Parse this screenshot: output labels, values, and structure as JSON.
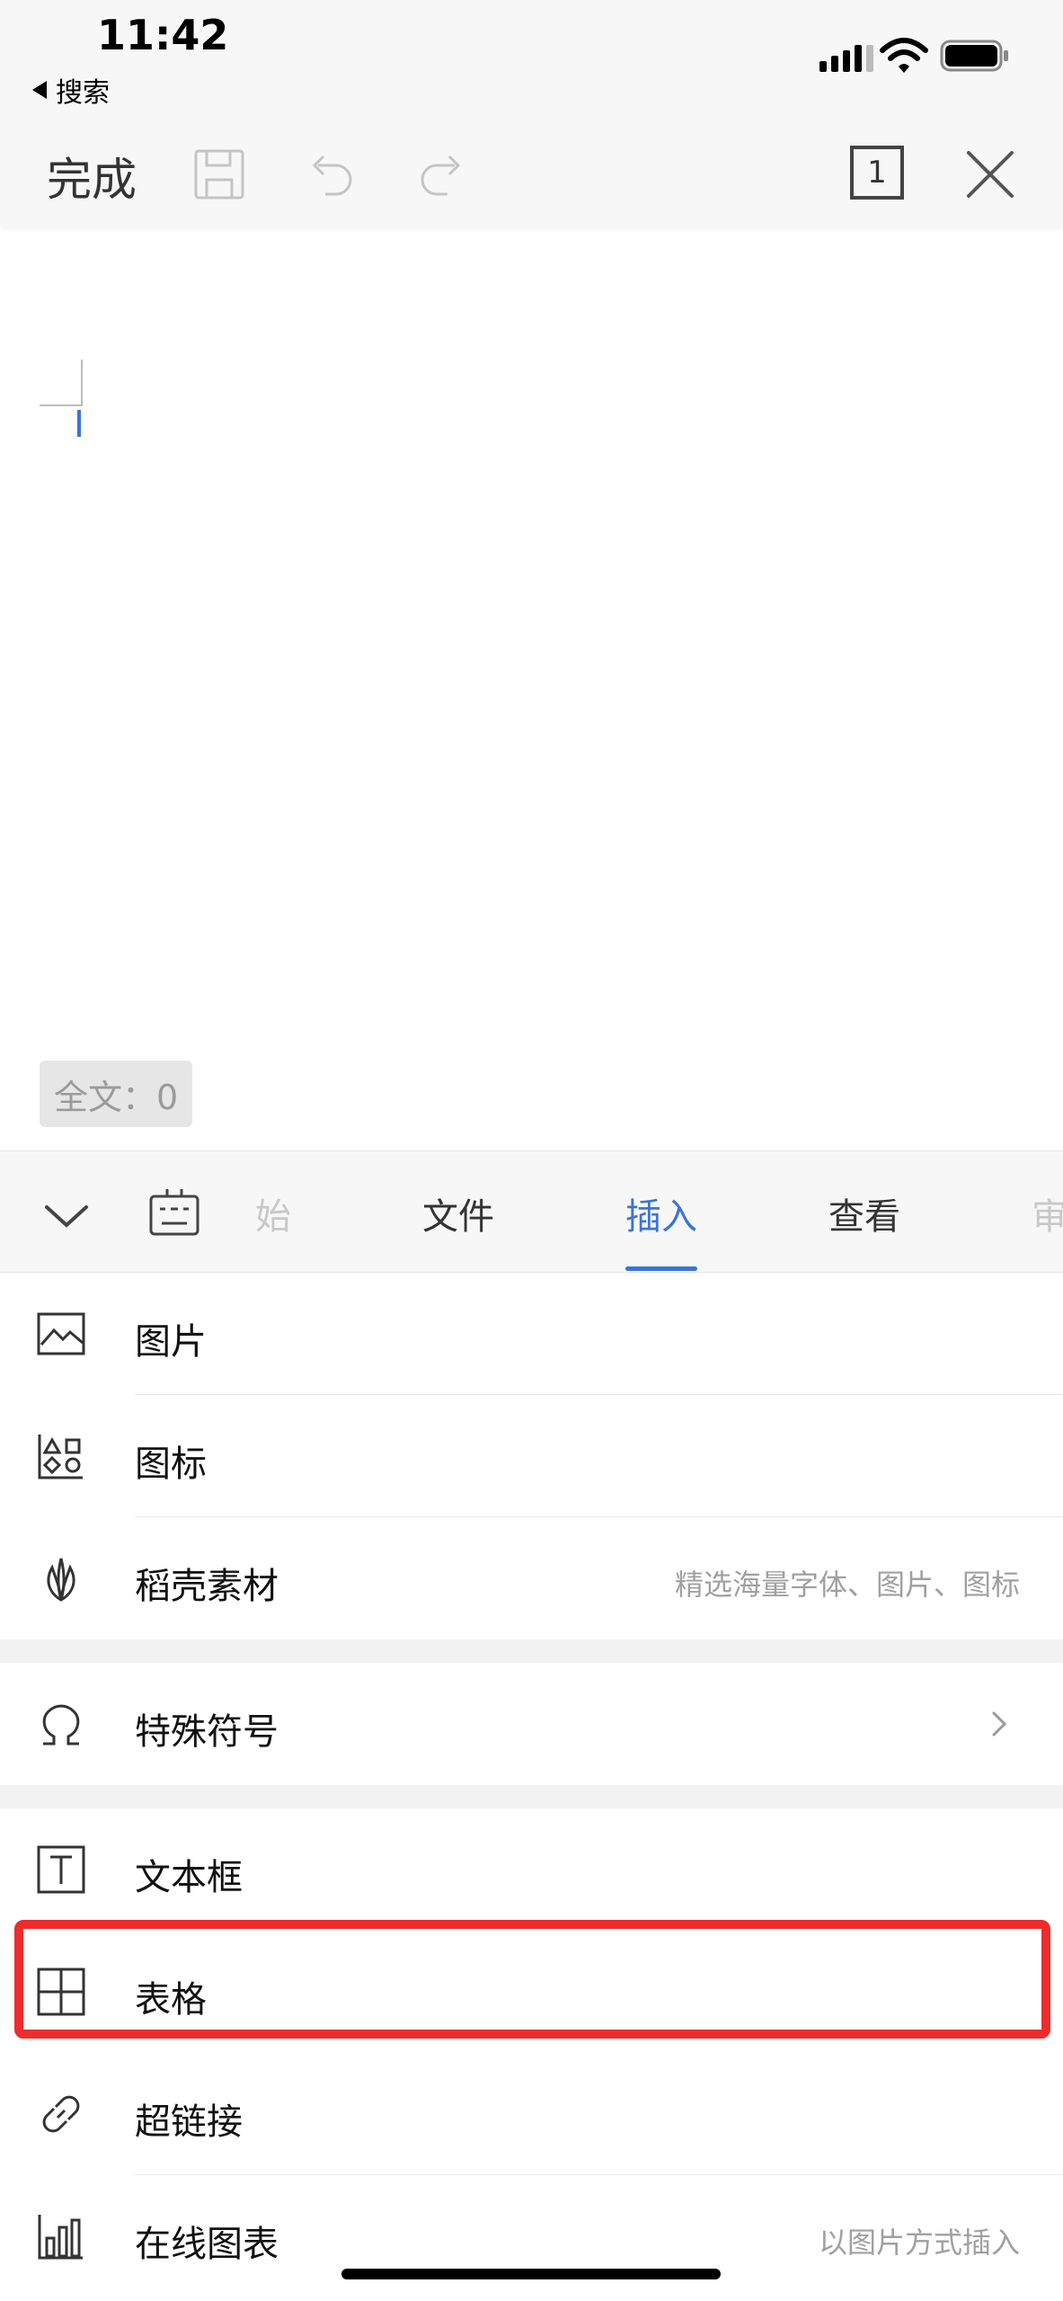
{
  "status_bar": {
    "time": "11:42",
    "back_label": "搜索"
  },
  "toolbar": {
    "done_label": "完成",
    "page_count": "1"
  },
  "document": {
    "word_count": "全文：0"
  },
  "tabs": [
    {
      "label": "始",
      "state": "faded"
    },
    {
      "label": "文件",
      "state": "normal"
    },
    {
      "label": "插入",
      "state": "active"
    },
    {
      "label": "查看",
      "state": "normal"
    },
    {
      "label": "审",
      "state": "faded"
    }
  ],
  "menu": {
    "picture": {
      "label": "图片",
      "icon": "image-icon"
    },
    "icons": {
      "label": "图标",
      "icon": "shapes-icon"
    },
    "materials": {
      "label": "稻壳素材",
      "hint": "精选海量字体、图片、图标",
      "icon": "leaf-icon"
    },
    "symbols": {
      "label": "特殊符号",
      "icon": "omega-icon"
    },
    "textbox": {
      "label": "文本框",
      "icon": "text-box-icon"
    },
    "table": {
      "label": "表格",
      "icon": "table-icon"
    },
    "hyperlink": {
      "label": "超链接",
      "icon": "link-icon"
    },
    "online_chart": {
      "label": "在线图表",
      "hint": "以图片方式插入",
      "icon": "bar-chart-icon"
    }
  },
  "colors": {
    "accent": "#3b74d8",
    "highlight": "#ee2c2c"
  }
}
